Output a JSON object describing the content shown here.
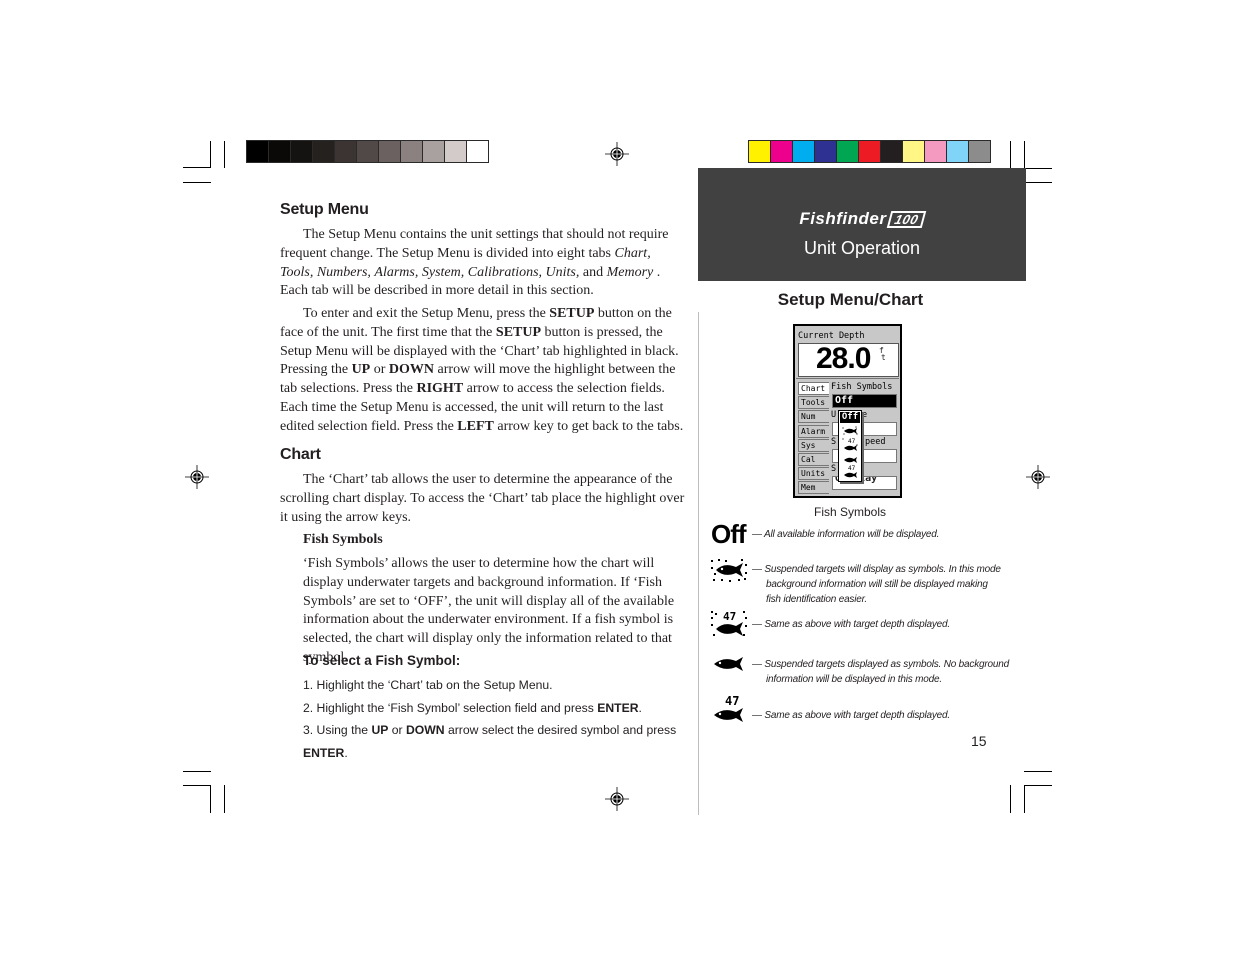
{
  "print_marks": {
    "grayscale_bar": [
      "#000000",
      "#0b0908",
      "#151312",
      "#24211f",
      "#3b3432",
      "#514947",
      "#6b6160",
      "#8a8180",
      "#a8a1a0",
      "#d2cbc9",
      "#ffffff"
    ],
    "color_bar": [
      "#fff100",
      "#ec008c",
      "#00aeef",
      "#2e3192",
      "#00a651",
      "#ed1c24",
      "#231f20",
      "#fff685",
      "#f49ac1",
      "#7fd4f7",
      "#8c8c8c"
    ]
  },
  "left": {
    "setup_menu": {
      "heading": "Setup Menu",
      "p1_a": "The Setup Menu contains the unit settings that should not require frequent change.  The Setup Menu is divided into eight tabs ",
      "tabs_italic": [
        "Chart,",
        "Tools,",
        "Numbers,",
        "Alarms,",
        "System,",
        "Calibrations,",
        "Units,"
      ],
      "p1_and": "and",
      "p1_memory": "Memory",
      "p1_b": " .  Each tab will be described in more detail in this section.",
      "p2_1": "To enter and exit the Setup Menu, press the ",
      "p2_setup": "SETUP",
      "p2_2": " button on the face of the unit.  The first time that the ",
      "p2_3": " button is pressed, the Setup Menu will be displayed with the ‘Chart’ tab highlighted in black. Pressing the ",
      "p2_up": "UP",
      "p2_or": " or ",
      "p2_down": "DOWN",
      "p2_4": " arrow will move the highlight between the tab selections. Press the ",
      "p2_right": "RIGHT",
      "p2_5": " arrow to access the selection fields.  Each time the Setup Menu is accessed, the unit will return to the last edited selection field.  Press the ",
      "p2_left": "LEFT",
      "p2_6": " arrow key to get back to the tabs."
    },
    "chart": {
      "heading": "Chart",
      "p1": "The ‘Chart’ tab allows the user to determine the appearance of the scrolling chart display.  To access the ‘Chart’ tab place the highlight over it using the arrow keys.",
      "fish_heading": "Fish Symbols",
      "fish_p": " ‘Fish Symbols’ allows the user to determine how the chart will display underwater targets and background information.  If ‘Fish Symbols’ are set to ‘OFF’, the unit will display all of the available information about the underwater environment.  If a fish symbol is selected, the chart will display only the information related to that symbol."
    },
    "steps": {
      "title": "To select a Fish Symbol:",
      "s1": "1. Highlight the ‘Chart’ tab on the Setup Menu.",
      "s2_a": "2. Highlight the ‘Fish Symbol’ selection field and press ",
      "s3_a": "3. Using the ",
      "s3_up": "UP",
      "s3_or": " or ",
      "s3_down": "DOWN",
      "s3_b": " arrow select the desired symbol and press ",
      "enter": "ENTER",
      "period": "."
    }
  },
  "right": {
    "brand": "Fishfinder",
    "model": "100",
    "section": "Unit Operation",
    "title": "Setup Menu/Chart",
    "device": {
      "depth_label": "Current Depth",
      "depth_value": "28.0",
      "depth_unit_f": "f",
      "depth_unit_t": "t",
      "tabs": [
        "Chart",
        "Tools",
        "Num",
        "Alarm",
        "Sys",
        "Cal",
        "Units",
        "Mem"
      ],
      "active_tab": "Chart",
      "field_label": "Fish Symbols",
      "field_value": "Off",
      "partial_label_1": "U",
      "partial_label_1b": "e",
      "partial_label_2": "S",
      "partial_label_2b": "peed",
      "partial_label_3": "S",
      "bottom_value": "Overlay",
      "popup_selected": "Off",
      "popup_depth": "47"
    },
    "caption": "Fish Symbols",
    "legend": [
      {
        "symbol": "Off",
        "icon": "off-text",
        "desc": [
          "— All available information will be displayed."
        ]
      },
      {
        "symbol": "fish-with-background",
        "icon": "fish-dotted-icon",
        "desc": [
          "— Suspended targets will display as symbols. In this mode",
          "background information will still be displayed making",
          "fish identification easier."
        ]
      },
      {
        "symbol": "fish-with-background-depth",
        "icon": "fish-dotted-depth-icon",
        "depth": "47",
        "desc": [
          "— Same as above with target depth displayed."
        ]
      },
      {
        "symbol": "fish",
        "icon": "fish-icon",
        "desc": [
          "— Suspended targets displayed as symbols.  No background",
          "information will be displayed in this mode."
        ]
      },
      {
        "symbol": "fish-depth",
        "icon": "fish-depth-icon",
        "depth": "47",
        "desc": [
          "— Same as above with target depth displayed."
        ]
      }
    ],
    "page_number": "15"
  }
}
